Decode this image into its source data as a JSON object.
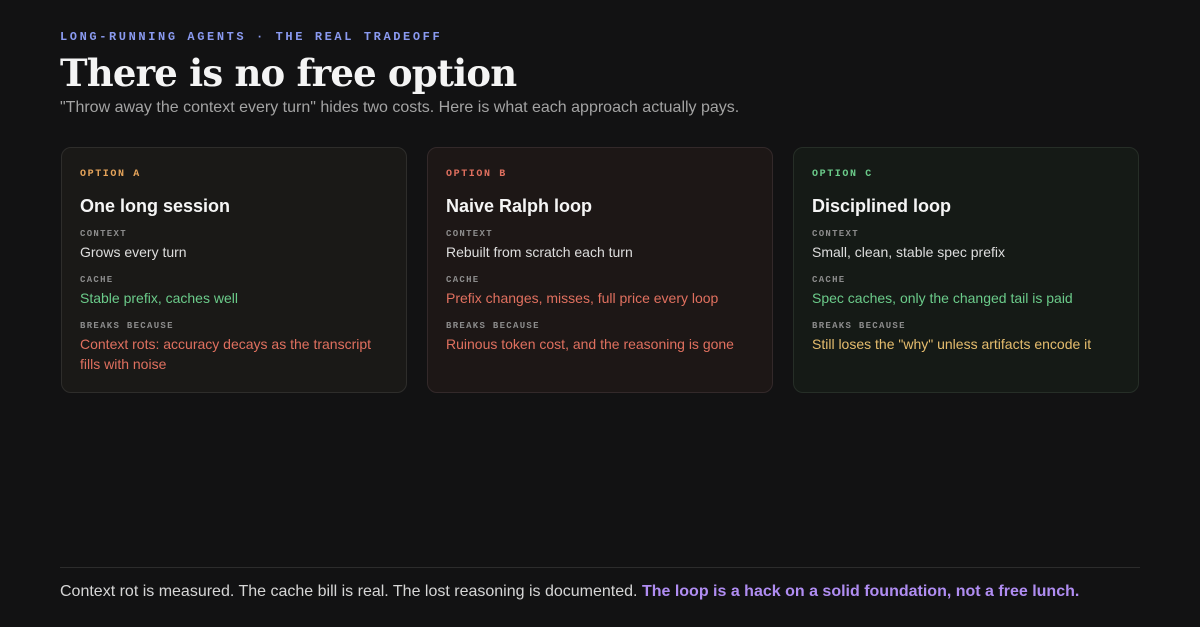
{
  "header": {
    "kicker": "LONG-RUNNING AGENTS · THE REAL TRADEOFF",
    "title": "There is no free option",
    "subtitle": "\"Throw away the context every turn\" hides two costs. Here is what each approach actually pays."
  },
  "field_labels": {
    "context": "CONTEXT",
    "cache": "CACHE",
    "breaks": "BREAKS BECAUSE"
  },
  "options": [
    {
      "label": "OPTION A",
      "title": "One long session",
      "context": "Grows every turn",
      "cache": "Stable prefix, caches well",
      "breaks": "Context rots: accuracy decays as the transcript fills with noise"
    },
    {
      "label": "OPTION B",
      "title": "Naive Ralph loop",
      "context": "Rebuilt from scratch each turn",
      "cache": "Prefix changes, misses, full price every loop",
      "breaks": "Ruinous token cost, and the reasoning is gone"
    },
    {
      "label": "OPTION C",
      "title": "Disciplined loop",
      "context": "Small, clean, stable spec prefix",
      "cache": "Spec caches, only the changed tail is paid",
      "breaks": "Still loses the \"why\" unless artifacts encode it"
    }
  ],
  "colors": {
    "background": "#121213",
    "kicker": "#8a9af0",
    "option_a": "#e6a45a",
    "option_b": "#e0705f",
    "option_c": "#6bcb8a",
    "good": "#6bcb8a",
    "bad": "#e0705f",
    "warn": "#e6bd6e",
    "emphasis": "#b08df2"
  },
  "footer": {
    "text": "Context rot is measured. The cache bill is real. The lost reasoning is documented.",
    "emphasis": "The loop is a hack on a solid foundation, not a free lunch."
  }
}
